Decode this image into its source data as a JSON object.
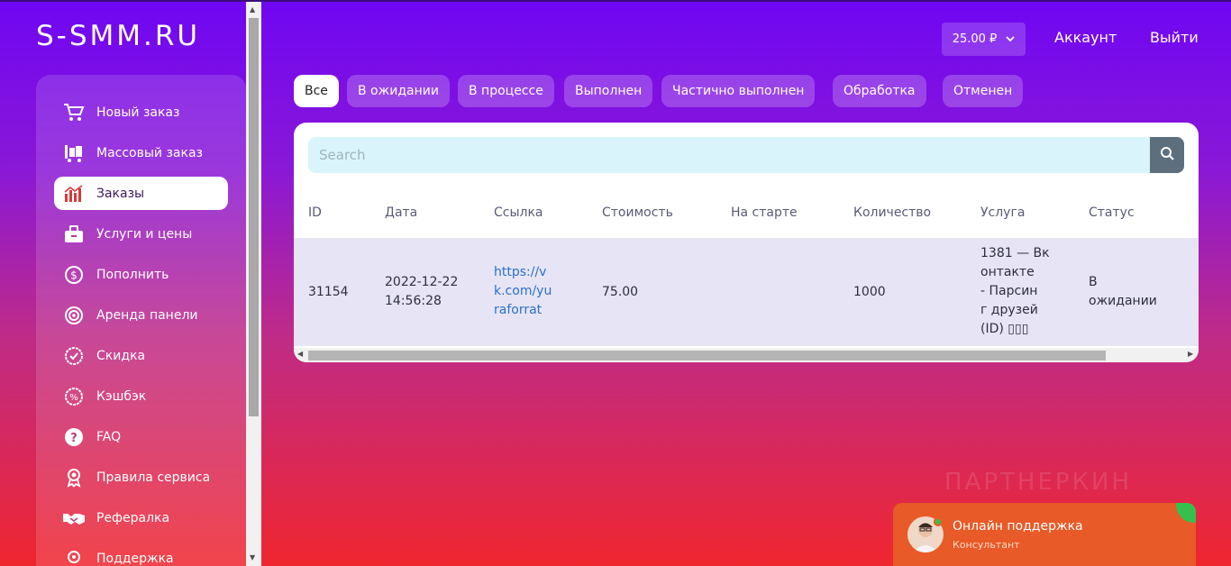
{
  "brand": {
    "logo": "S-SMM.RU"
  },
  "header": {
    "balance": "25.00 ₽",
    "account_label": "Аккаунт",
    "logout_label": "Выйти"
  },
  "sidebar": {
    "items": [
      {
        "label": "Новый заказ",
        "icon": "cart-icon"
      },
      {
        "label": "Массовый заказ",
        "icon": "bulk-cart-icon"
      },
      {
        "label": "Заказы",
        "icon": "chart-bars-icon"
      },
      {
        "label": "Услуги и цены",
        "icon": "price-tag-icon"
      },
      {
        "label": "Пополнить",
        "icon": "dollar-circle-icon"
      },
      {
        "label": "Аренда панели",
        "icon": "target-icon"
      },
      {
        "label": "Скидка",
        "icon": "badge-check-icon"
      },
      {
        "label": "Кэшбэк",
        "icon": "percent-badge-icon"
      },
      {
        "label": "FAQ",
        "icon": "question-icon"
      },
      {
        "label": "Правила сервиса",
        "icon": "award-icon"
      },
      {
        "label": "Рефералка",
        "icon": "handshake-icon"
      },
      {
        "label": "Поддержка",
        "icon": "support-icon"
      }
    ],
    "active_index": 2
  },
  "filters": {
    "tabs": [
      "Все",
      "В ожидании",
      "В процессе",
      "Выполнен",
      "Частично выполнен",
      "Обработка",
      "Отменен"
    ],
    "active_index": 0
  },
  "search": {
    "placeholder": "Search"
  },
  "table": {
    "columns": [
      "ID",
      "Дата",
      "Ссылка",
      "Стоимость",
      "На старте",
      "Количество",
      "Услуга",
      "Статус"
    ],
    "rows": [
      {
        "id": "31154",
        "date_line1": "2022-12-22",
        "date_line2": "14:56:28",
        "link": [
          "https://v",
          "k.com/yu",
          "raforrat"
        ],
        "cost": "75.00",
        "start": "",
        "quantity": "1000",
        "service": [
          "1381 — Вк",
          "онтакте",
          "- Парсин",
          "г друзей",
          "(ID) ▯▯▯"
        ],
        "status": [
          "В",
          "ожидании"
        ]
      }
    ]
  },
  "watermark": "ПАРТНЕРКИН",
  "chat": {
    "title": "Онлайн поддержка",
    "subtitle": "Консультант"
  },
  "colors": {
    "accent_red": "#d63a3a",
    "chat_orange": "#e85a27",
    "online_green": "#35c04d",
    "link_blue": "#2a6fc9"
  }
}
